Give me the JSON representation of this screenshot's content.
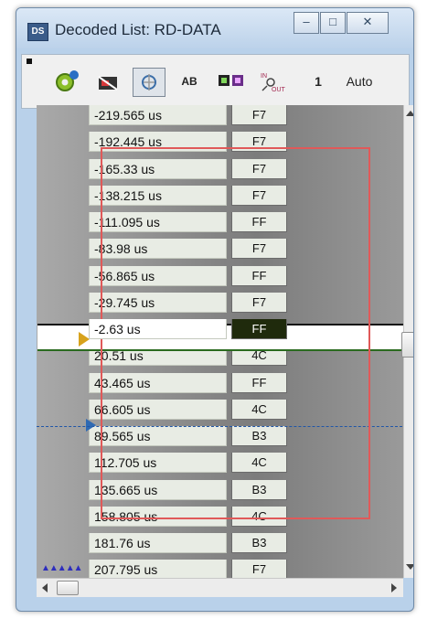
{
  "window": {
    "title": "Decoded List: RD-DATA",
    "app_icon_text": "DS",
    "controls": {
      "minimize": "–",
      "maximize": "□",
      "close": "✕"
    }
  },
  "toolbar": {
    "items": [
      {
        "name": "settings-gear-icon"
      },
      {
        "name": "erase-icon"
      },
      {
        "name": "decode-format-toggle-icon",
        "pressed": true
      },
      {
        "name": "ascii-toggle-icon",
        "label": "AB"
      },
      {
        "name": "export-icon"
      },
      {
        "name": "in-out-icon"
      }
    ],
    "channel_label": "1",
    "mode_label": "Auto"
  },
  "rows": [
    {
      "time": "-219.565 us",
      "value": "F7"
    },
    {
      "time": "-192.445 us",
      "value": "F7"
    },
    {
      "time": "-165.33 us",
      "value": "F7"
    },
    {
      "time": "-138.215 us",
      "value": "F7"
    },
    {
      "time": "-111.095 us",
      "value": "FF"
    },
    {
      "time": "-83.98 us",
      "value": "F7"
    },
    {
      "time": "-56.865 us",
      "value": "FF"
    },
    {
      "time": "-29.745 us",
      "value": "F7"
    },
    {
      "time": "-2.63 us",
      "value": "FF",
      "selected": true
    },
    {
      "time": "20.51 us",
      "value": "4C"
    },
    {
      "time": "43.465 us",
      "value": "FF"
    },
    {
      "time": "66.605 us",
      "value": "4C"
    },
    {
      "time": "89.565 us",
      "value": "B3"
    },
    {
      "time": "112.705 us",
      "value": "4C"
    },
    {
      "time": "135.665 us",
      "value": "B3"
    },
    {
      "time": "158.805 us",
      "value": "4C"
    },
    {
      "time": "181.76 us",
      "value": "B3"
    },
    {
      "time": "207.795 us",
      "value": "F7"
    }
  ],
  "colors": {
    "highlight_box": "#e05959",
    "cursor": "#2056a8",
    "selected_bg": "#1f2a0c"
  }
}
